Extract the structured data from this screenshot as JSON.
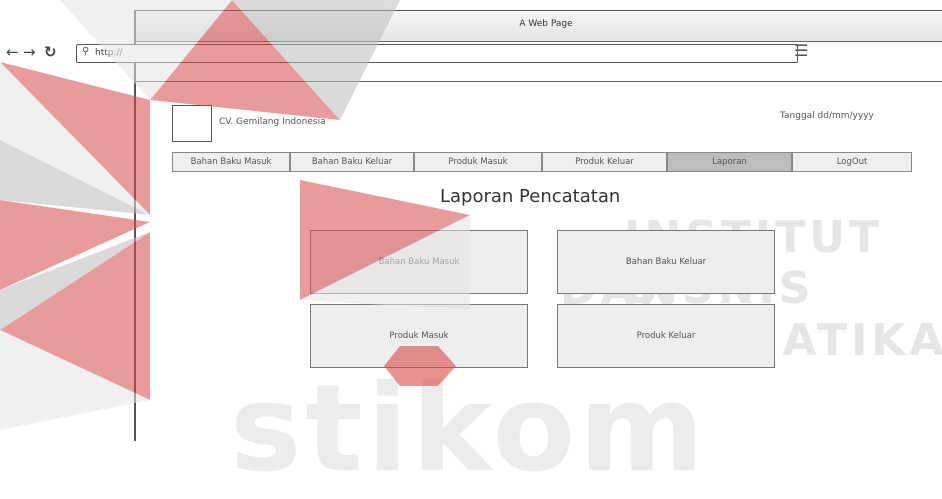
{
  "browser": {
    "window_title": "A Web Page",
    "url": "http://"
  },
  "header": {
    "company_name": "CV. Gemilang Indonesia",
    "date_label": "Tanggal dd/mm/yyyy"
  },
  "nav": {
    "items": [
      {
        "label": "Bahan Baku Masuk"
      },
      {
        "label": "Bahan Baku Keluar"
      },
      {
        "label": "Produk Masuk"
      },
      {
        "label": "Produk Keluar"
      },
      {
        "label": "Laporan"
      },
      {
        "label": "LogOut"
      }
    ],
    "active": "Laporan"
  },
  "main": {
    "heading": "Laporan Pencatatan",
    "reports": [
      {
        "label": "Bahan Baku Masuk"
      },
      {
        "label": "Bahan Baku Keluar"
      },
      {
        "label": "Produk Masuk"
      },
      {
        "label": "Produk Keluar"
      }
    ]
  },
  "watermark": {
    "line1": "INSTITUT BISNIS",
    "line2": "DAN INFORMATIKA",
    "line3": "stikom"
  },
  "colors": {
    "watermark_red": "#d8494b",
    "watermark_grey": "#e4e4e4",
    "active_tab": "#bdbdbd"
  }
}
